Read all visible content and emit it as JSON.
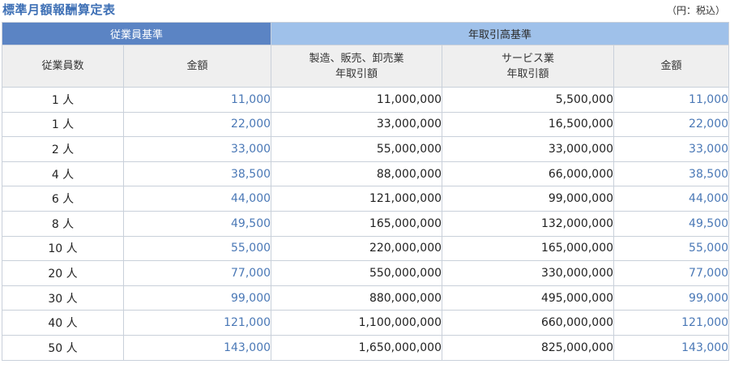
{
  "header": {
    "title": "標準月額報酬算定表",
    "unit_note": "（円：税込）"
  },
  "table": {
    "group_headers": {
      "employee": "従業員基準",
      "revenue": "年取引高基準"
    },
    "columns": {
      "count": "従業員数",
      "amount": "金額",
      "manufacturing_line1": "製造、販売、卸売業",
      "manufacturing_line2": "年取引額",
      "service_line1": "サービス業",
      "service_line2": "年取引額",
      "amount2": "金額"
    },
    "rows": [
      [
        "1 人",
        "11,000",
        "11,000,000",
        "5,500,000",
        "11,000"
      ],
      [
        "1 人",
        "22,000",
        "33,000,000",
        "16,500,000",
        "22,000"
      ],
      [
        "2 人",
        "33,000",
        "55,000,000",
        "33,000,000",
        "33,000"
      ],
      [
        "4 人",
        "38,500",
        "88,000,000",
        "66,000,000",
        "38,500"
      ],
      [
        "6 人",
        "44,000",
        "121,000,000",
        "99,000,000",
        "44,000"
      ],
      [
        "8 人",
        "49,500",
        "165,000,000",
        "132,000,000",
        "49,500"
      ],
      [
        "10 人",
        "55,000",
        "220,000,000",
        "165,000,000",
        "55,000"
      ],
      [
        "20 人",
        "77,000",
        "550,000,000",
        "330,000,000",
        "77,000"
      ],
      [
        "30 人",
        "99,000",
        "880,000,000",
        "495,000,000",
        "99,000"
      ],
      [
        "40 人",
        "121,000",
        "1,100,000,000",
        "660,000,000",
        "121,000"
      ],
      [
        "50 人",
        "143,000",
        "1,650,000,000",
        "825,000,000",
        "143,000"
      ]
    ]
  },
  "colors": {
    "title": "#3d6fb5",
    "employee_header": "#5b84c4",
    "revenue_header": "#9fc1ea",
    "amount_text": "#4a78b6"
  }
}
